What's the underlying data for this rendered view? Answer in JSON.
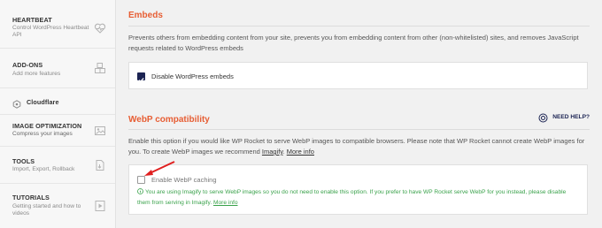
{
  "sidebar": {
    "items": [
      {
        "title": "HEARTBEAT",
        "desc": "Control WordPress Heartbeat API",
        "icon": "heartbeat-icon"
      },
      {
        "title": "ADD-ONS",
        "desc": "Add more features",
        "icon": "addons-icon"
      },
      {
        "title": "Cloudflare",
        "desc": "",
        "icon": "cloudflare-icon"
      },
      {
        "title": "IMAGE OPTIMIZATION",
        "desc": "Compress your images",
        "icon": "image-icon"
      },
      {
        "title": "TOOLS",
        "desc": "Import, Export, Rollback",
        "icon": "tools-icon"
      },
      {
        "title": "TUTORIALS",
        "desc": "Getting started and how to videos",
        "icon": "video-icon"
      }
    ]
  },
  "embeds": {
    "title": "Embeds",
    "description": "Prevents others from embedding content from your site, prevents you from embedding content from other (non-whitelisted) sites, and removes JavaScript requests related to WordPress embeds",
    "checkbox_label": "Disable WordPress embeds",
    "checked": true
  },
  "webp": {
    "title": "WebP compatibility",
    "need_help": "NEED HELP?",
    "description_part1": "Enable this option if you would like WP Rocket to serve WebP images to compatible browsers. Please note that WP Rocket cannot create WebP images for you. To create WebP images we recommend",
    "imagify_link": "Imagify",
    "more_info": "More info",
    "checkbox_label": "Enable WebP caching",
    "checked": false,
    "note": "You are using Imagify to serve WebP images so you do not need to enable this option. If you prefer to have WP Rocket serve WebP for you instead, please disable them from serving in Imagify.",
    "note_link": "More info"
  },
  "colors": {
    "accent": "#e75e34",
    "brand_dark": "#1c2453",
    "success": "#3aa24b",
    "arrow": "#e02020"
  }
}
